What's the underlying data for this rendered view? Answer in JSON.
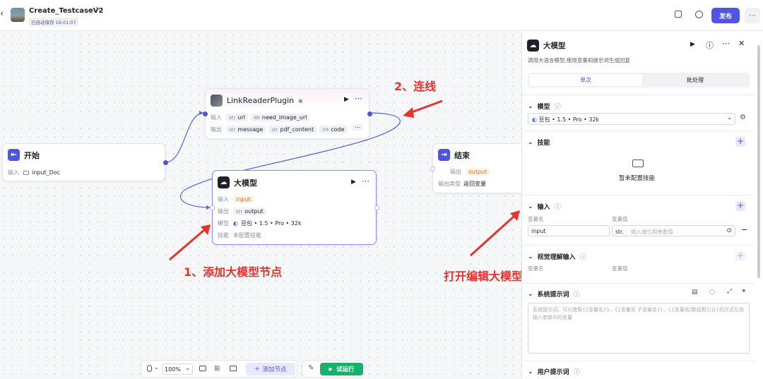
{
  "header": {
    "title": "Create_TestcaseV2",
    "autosave": "已自动保存 16:01:07",
    "publish_label": "发布"
  },
  "nodes": {
    "plugin": {
      "title": "LinkReaderPlugin",
      "in_label": "输入",
      "in_tags": [
        {
          "type": "str",
          "name": "url"
        },
        {
          "type": "",
          "name": "need_image_url"
        }
      ],
      "out_label": "输出",
      "out_tags": [
        {
          "type": "str",
          "name": "message"
        },
        {
          "type": "str",
          "name": "pdf_content"
        },
        {
          "type": "int",
          "name": "code"
        }
      ]
    },
    "start": {
      "title": "开始",
      "in_label": "输入",
      "in_value": "input_Doc"
    },
    "llm": {
      "title": "大模型",
      "in_label": "输入",
      "in_value": "input",
      "out_label": "输出",
      "out_type": "str",
      "out_value": "output",
      "model_label": "模型",
      "model_value": "豆包 • 1.5 • Pro • 32k",
      "skill_label": "技能",
      "skill_value": "未配置技能"
    },
    "end": {
      "title": "结束",
      "out_label": "输出",
      "out_value": "output",
      "type_label": "输出类型",
      "type_value": "返回变量"
    }
  },
  "toolbar": {
    "zoom": "100%",
    "add_node": "添加节点",
    "run": "试运行"
  },
  "annotations": {
    "connect": "2、连线",
    "add_node": "1、添加大模型节点",
    "open_editor": "打开编辑大模型窗口"
  },
  "panel": {
    "title": "大模型",
    "desc": "调用大语言模型,使用变量和提示词生成回复",
    "tabs": [
      "单次",
      "批处理"
    ],
    "model_section": "模型",
    "model_value": "豆包 • 1.5 • Pro • 32k",
    "skill_section": "技能",
    "skill_empty": "暂未配置技能",
    "input_section": "输入",
    "col_name": "变量名",
    "col_value": "变量值",
    "input_name": "input",
    "input_type": "str.",
    "input_placeholder": "输入或引用参数值",
    "vision_section": "视觉理解输入",
    "vision_col_name": "变量名",
    "vision_col_value": "变量值",
    "system_section": "系统提示词",
    "system_placeholder": "系统提示词，可以使用{{变量名}}、{{变量名.子变量名}}、{{变量名[数组索引]}}的方式引用输入参数中的变量",
    "user_section": "用户提示词"
  },
  "colors": {
    "accent": "#4e55e0",
    "run_green": "#17b26a",
    "annotation_red": "#e8322c"
  }
}
